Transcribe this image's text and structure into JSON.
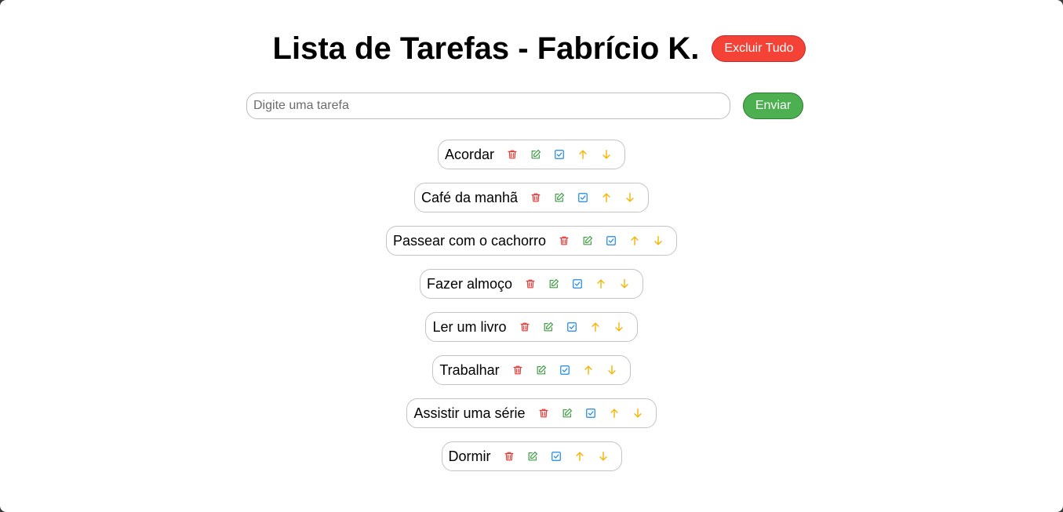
{
  "header": {
    "title": "Lista de Tarefas - Fabrício K.",
    "clear_label": "Excluir Tudo"
  },
  "form": {
    "placeholder": "Digite uma tarefa",
    "value": "",
    "send_label": "Enviar"
  },
  "colors": {
    "delete": "#e53935",
    "edit": "#43a047",
    "complete": "#1e88e5",
    "move": "#f4b400",
    "clear_button": "#f44336",
    "send_button": "#4caf50"
  },
  "actions": {
    "delete_icon": "trash-icon",
    "edit_icon": "edit-icon",
    "complete_icon": "checkbox-icon",
    "up_icon": "arrow-up-icon",
    "down_icon": "arrow-down-icon"
  },
  "tasks": [
    {
      "text": "Acordar"
    },
    {
      "text": "Café da manhã"
    },
    {
      "text": "Passear com o cachorro"
    },
    {
      "text": "Fazer almoço"
    },
    {
      "text": "Ler um livro"
    },
    {
      "text": "Trabalhar"
    },
    {
      "text": "Assistir uma série"
    },
    {
      "text": "Dormir"
    }
  ]
}
